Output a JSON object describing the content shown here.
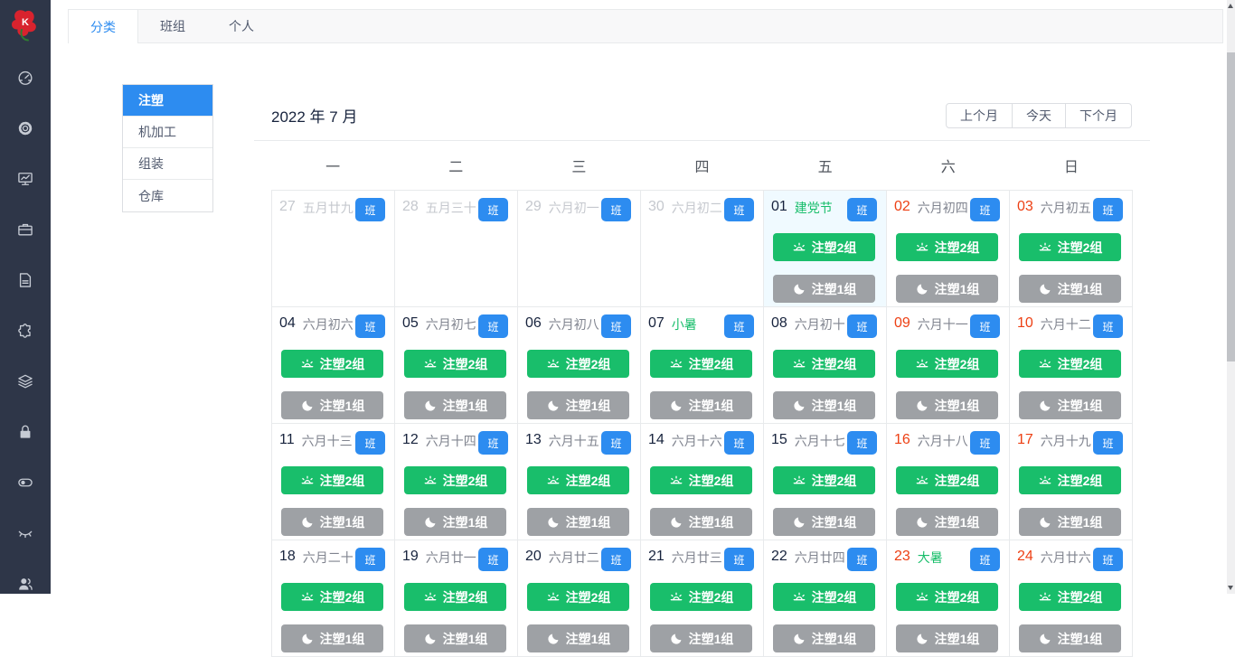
{
  "tabs": [
    {
      "label": "分类",
      "active": true
    },
    {
      "label": "班组",
      "active": false
    },
    {
      "label": "个人",
      "active": false
    }
  ],
  "sidebar": {
    "icons": [
      "dashboard-icon",
      "gear-icon",
      "presentation-chart-icon",
      "briefcase-icon",
      "document-icon",
      "puzzle-icon",
      "layers-icon",
      "lock-icon",
      "toggle-icon",
      "eye-closed-icon",
      "team-icon"
    ]
  },
  "categories": [
    {
      "label": "注塑",
      "active": true
    },
    {
      "label": "机加工",
      "active": false
    },
    {
      "label": "组装",
      "active": false
    },
    {
      "label": "仓库",
      "active": false
    }
  ],
  "calendar": {
    "title": "2022 年 7 月",
    "controls": [
      {
        "label": "上个月"
      },
      {
        "label": "今天"
      },
      {
        "label": "下个月"
      }
    ],
    "weekdays": [
      "一",
      "二",
      "三",
      "四",
      "五",
      "六",
      "日"
    ],
    "badge_label": "班",
    "shift_buttons": {
      "day": {
        "label": "注塑2组",
        "color": "#19be6b",
        "icon": "sunrise-icon"
      },
      "night": {
        "label": "注塑1组",
        "color": "#9ea1a5",
        "icon": "moon-icon"
      }
    },
    "colors": {
      "primary": "#2d8cf0",
      "success": "#19be6b",
      "weekend_red": "#ed4014",
      "outside_gray": "#c5c8ce",
      "today_bg": "#f0faff",
      "night_gray": "#9ea1a5",
      "sidebar_bg": "#2e3648"
    },
    "cells": [
      {
        "day": "27",
        "lunar": "五月廿九",
        "out": true
      },
      {
        "day": "28",
        "lunar": "五月三十",
        "out": true
      },
      {
        "day": "29",
        "lunar": "六月初一",
        "out": true
      },
      {
        "day": "30",
        "lunar": "六月初二",
        "out": true
      },
      {
        "day": "01",
        "lunar": "建党节",
        "special": true,
        "today": true,
        "shifts": true
      },
      {
        "day": "02",
        "lunar": "六月初四",
        "red": true,
        "shifts": true
      },
      {
        "day": "03",
        "lunar": "六月初五",
        "red": true,
        "shifts": true
      },
      {
        "day": "04",
        "lunar": "六月初六",
        "shifts": true
      },
      {
        "day": "05",
        "lunar": "六月初七",
        "shifts": true
      },
      {
        "day": "06",
        "lunar": "六月初八",
        "shifts": true
      },
      {
        "day": "07",
        "lunar": "小暑",
        "special": true,
        "shifts": true
      },
      {
        "day": "08",
        "lunar": "六月初十",
        "shifts": true
      },
      {
        "day": "09",
        "lunar": "六月十一",
        "red": true,
        "shifts": true
      },
      {
        "day": "10",
        "lunar": "六月十二",
        "red": true,
        "shifts": true
      },
      {
        "day": "11",
        "lunar": "六月十三",
        "shifts": true
      },
      {
        "day": "12",
        "lunar": "六月十四",
        "shifts": true
      },
      {
        "day": "13",
        "lunar": "六月十五",
        "shifts": true
      },
      {
        "day": "14",
        "lunar": "六月十六",
        "shifts": true
      },
      {
        "day": "15",
        "lunar": "六月十七",
        "shifts": true
      },
      {
        "day": "16",
        "lunar": "六月十八",
        "red": true,
        "shifts": true
      },
      {
        "day": "17",
        "lunar": "六月十九",
        "red": true,
        "shifts": true
      },
      {
        "day": "18",
        "lunar": "六月二十",
        "shifts": true
      },
      {
        "day": "19",
        "lunar": "六月廿一",
        "shifts": true
      },
      {
        "day": "20",
        "lunar": "六月廿二",
        "shifts": true
      },
      {
        "day": "21",
        "lunar": "六月廿三",
        "shifts": true
      },
      {
        "day": "22",
        "lunar": "六月廿四",
        "shifts": true
      },
      {
        "day": "23",
        "lunar": "大暑",
        "red": true,
        "special": true,
        "shifts": true
      },
      {
        "day": "24",
        "lunar": "六月廿六",
        "red": true,
        "shifts": true
      }
    ]
  }
}
